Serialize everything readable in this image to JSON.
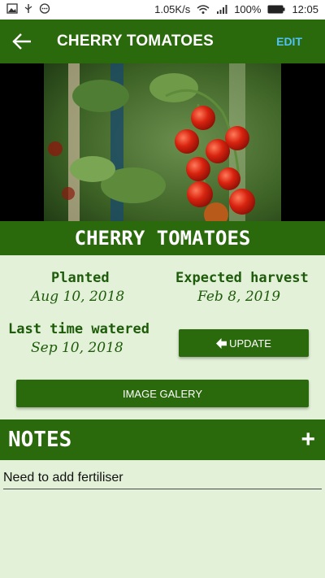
{
  "status": {
    "speed": "1.05K/s",
    "battery": "100%",
    "time": "12:05"
  },
  "header": {
    "title": "CHERRY TOMATOES",
    "edit_label": "EDIT"
  },
  "plant": {
    "name": "CHERRY TOMATOES",
    "planted_label": "Planted",
    "planted_date": "Aug 10, 2018",
    "harvest_label": "Expected harvest",
    "harvest_date": "Feb 8, 2019",
    "watered_label": "Last time watered",
    "watered_date": "Sep 10, 2018"
  },
  "buttons": {
    "update_label": "UPDATE",
    "gallery_label": "IMAGE GALERY"
  },
  "notes": {
    "title": "NOTES",
    "items": [
      "Need to add fertiliser"
    ]
  },
  "colors": {
    "primary": "#2b6a0c",
    "background": "#e3f1d8",
    "accent": "#4fc3f7",
    "text_green": "#1e5b0b"
  },
  "icons": {
    "back": "back-arrow-icon",
    "add": "plus-icon",
    "update": "arrow-left-icon"
  }
}
